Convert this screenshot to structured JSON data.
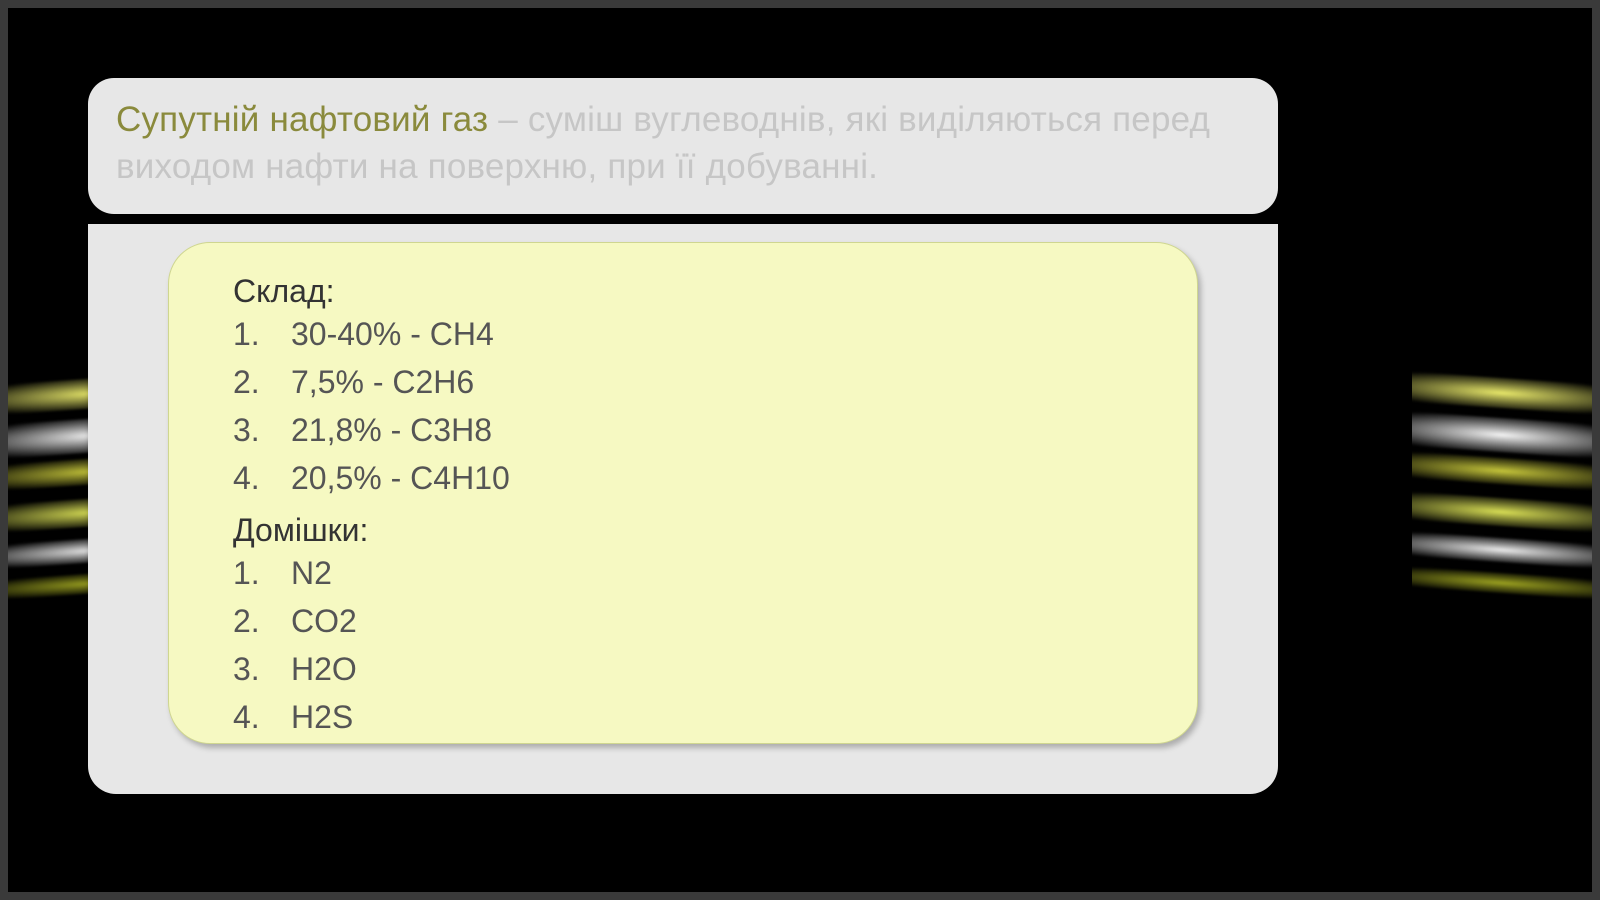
{
  "header": {
    "term": "Супутній нафтовий газ ",
    "sep": "– ",
    "definition": "суміш вуглеводнів, які виділяються перед виходом нафти на поверхню, при її добуванні."
  },
  "section1": {
    "label": "Склад:",
    "items": [
      "30-40% - СН4",
      "7,5% - С2Н6",
      "21,8% - С3Н8",
      "20,5% - С4Н10"
    ]
  },
  "section2": {
    "label": "Домішки:",
    "items": [
      "N2",
      "CO2",
      "H2O",
      "H2S"
    ]
  }
}
